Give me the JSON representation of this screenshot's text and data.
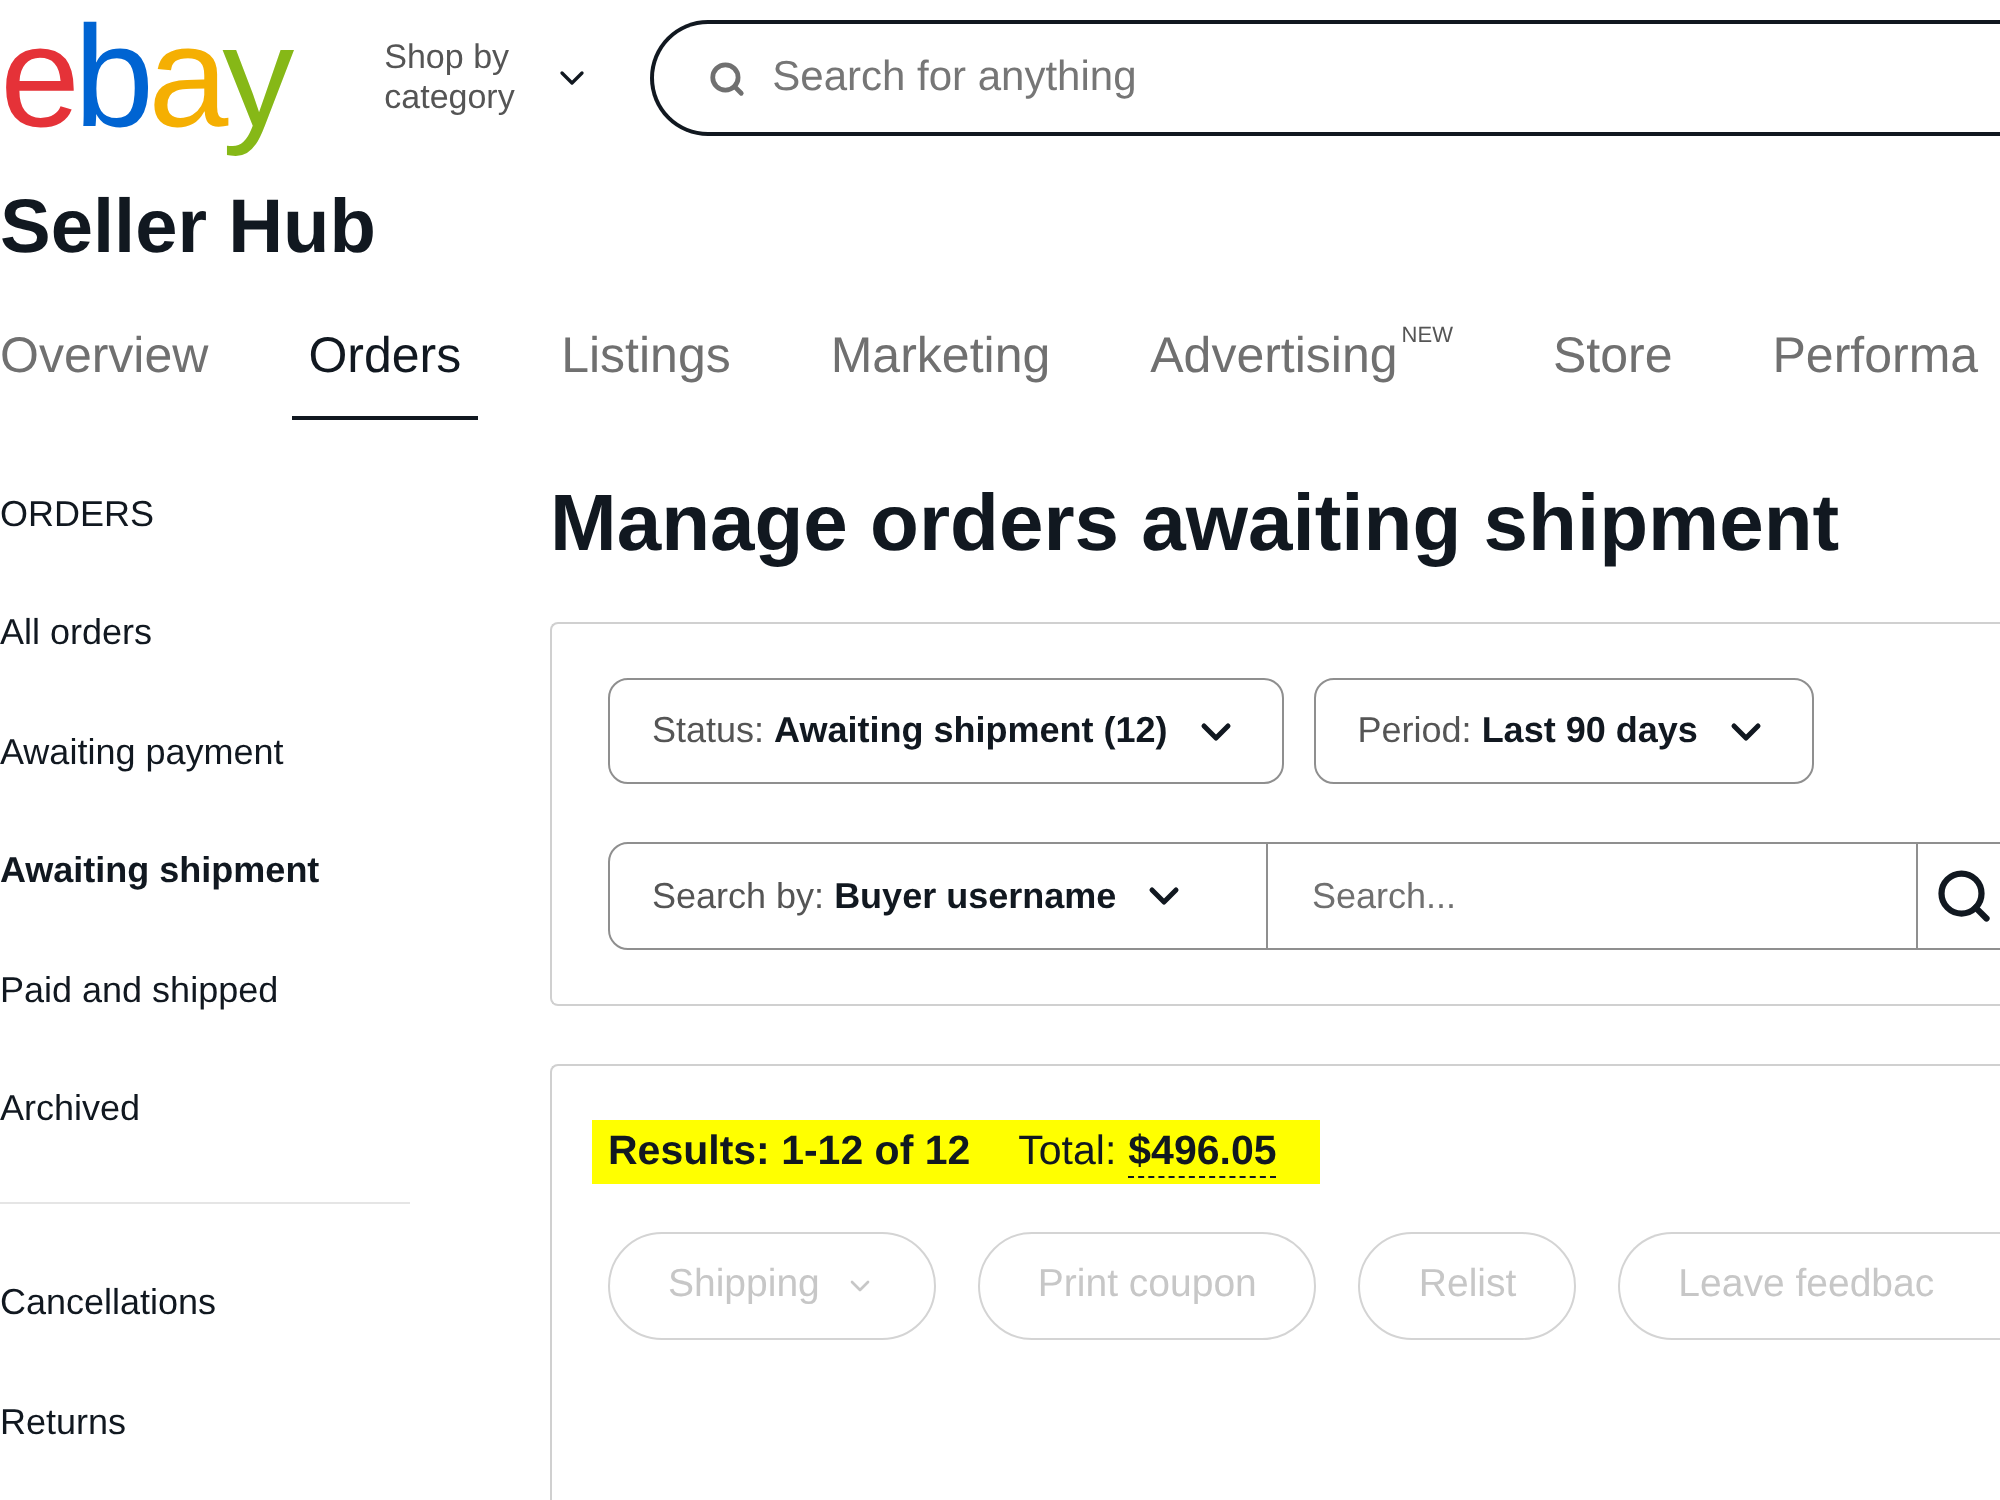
{
  "header": {
    "logo": "ebay",
    "category_menu": "Shop by category",
    "search": {
      "placeholder": "Search for anything"
    }
  },
  "page_title": "Seller Hub",
  "tabs": [
    {
      "label": "Overview",
      "selected": false
    },
    {
      "label": "Orders",
      "selected": true
    },
    {
      "label": "Listings",
      "selected": false
    },
    {
      "label": "Marketing",
      "selected": false
    },
    {
      "label": "Advertising",
      "note": "NEW",
      "selected": false
    },
    {
      "label": "Store",
      "selected": false
    },
    {
      "label": "Performa",
      "selected": false
    }
  ],
  "sidebar": {
    "heading": "ORDERS",
    "groups": [
      {
        "items": [
          {
            "label": "All orders",
            "selected": false
          },
          {
            "label": "Awaiting payment",
            "selected": false
          },
          {
            "label": "Awaiting shipment",
            "selected": true
          },
          {
            "label": "Paid and shipped",
            "selected": false
          },
          {
            "label": "Archived",
            "selected": false
          }
        ]
      },
      {
        "items": [
          {
            "label": "Cancellations",
            "selected": false
          },
          {
            "label": "Returns",
            "selected": false
          }
        ]
      }
    ]
  },
  "main": {
    "title": "Manage orders awaiting shipment",
    "filters": [
      {
        "label": "Status:",
        "value": "Awaiting shipment (12)"
      },
      {
        "label": "Period:",
        "value": "Last 90 days"
      }
    ],
    "search_by": {
      "label": "Search by:",
      "value": "Buyer username"
    },
    "search": {
      "placeholder": "Search..."
    }
  },
  "results": {
    "highlighted": true,
    "count": "Results: 1-12 of 12",
    "total_label": "Total:",
    "total_value": "$496.05",
    "actions": [
      {
        "label": "Shipping",
        "has_menu": true,
        "disabled": true
      },
      {
        "label": "Print coupon",
        "has_menu": false,
        "disabled": true
      },
      {
        "label": "Relist",
        "has_menu": false,
        "disabled": true
      },
      {
        "label": "Leave feedbac",
        "has_menu": false,
        "disabled": true
      }
    ]
  }
}
